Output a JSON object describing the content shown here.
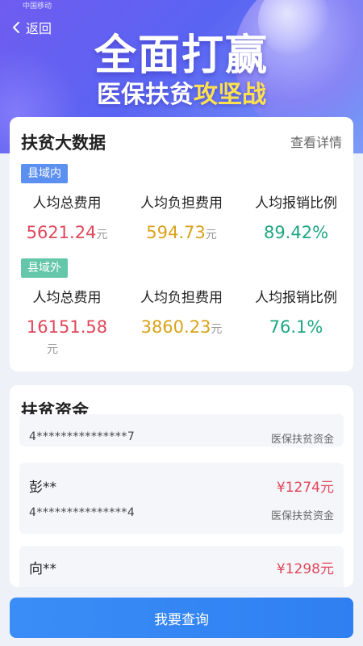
{
  "status_bar": {
    "text": "中国移动"
  },
  "header": {
    "back_label": "返回",
    "hero_title": "全面打赢",
    "hero_subtitle_main": "医保扶贫",
    "hero_subtitle_accent": "攻坚战"
  },
  "big_data": {
    "title": "扶贫大数据",
    "more_label": "查看详情",
    "in_county": {
      "tag": "县域内",
      "stats": [
        {
          "label": "人均总费用",
          "value": "5621.24",
          "unit": "元"
        },
        {
          "label": "人均负担费用",
          "value": "594.73",
          "unit": "元"
        },
        {
          "label": "人均报销比例",
          "value": "89.42%",
          "unit": ""
        }
      ]
    },
    "out_county": {
      "tag": "县域外",
      "stats": [
        {
          "label": "人均总费用",
          "value": "16151.58",
          "unit": "元"
        },
        {
          "label": "人均负担费用",
          "value": "3860.23",
          "unit": "元"
        },
        {
          "label": "人均报销比例",
          "value": "76.1%",
          "unit": ""
        }
      ]
    }
  },
  "funds": {
    "title": "扶贫资金",
    "items": [
      {
        "name": "",
        "amount": "",
        "id": "4***************7",
        "type": "医保扶贫资金"
      },
      {
        "name": "彭**",
        "amount": "¥1274元",
        "id": "4***************4",
        "type": "医保扶贫资金"
      },
      {
        "name": "向**",
        "amount": "¥1298元",
        "id": "",
        "type": ""
      }
    ]
  },
  "query_button": {
    "label": "我要查询"
  },
  "colors": {
    "primary": "#3a8df6",
    "red": "#e0475a",
    "gold": "#d9a21a",
    "green": "#1ea683"
  }
}
